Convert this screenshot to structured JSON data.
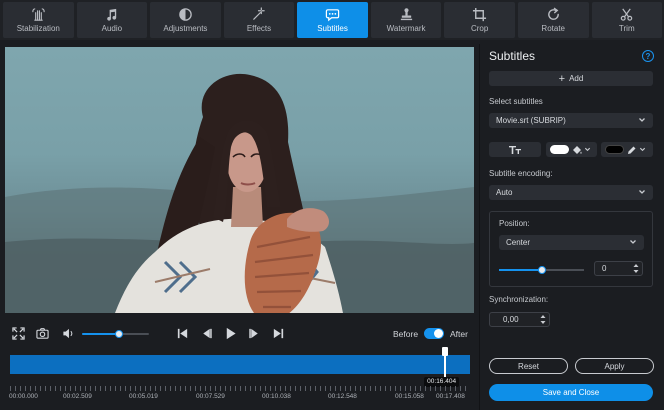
{
  "toolbar": {
    "tabs": [
      {
        "label": "Stabilization",
        "icon": "hand-icon"
      },
      {
        "label": "Audio",
        "icon": "music-note-icon"
      },
      {
        "label": "Adjustments",
        "icon": "contrast-icon"
      },
      {
        "label": "Effects",
        "icon": "magic-wand-icon"
      },
      {
        "label": "Subtitles",
        "icon": "speech-bubble-icon",
        "active": true
      },
      {
        "label": "Watermark",
        "icon": "stamp-icon"
      },
      {
        "label": "Crop",
        "icon": "crop-icon"
      },
      {
        "label": "Rotate",
        "icon": "rotate-icon"
      },
      {
        "label": "Trim",
        "icon": "scissors-icon"
      }
    ]
  },
  "player": {
    "before_label": "Before",
    "after_label": "After",
    "compare_enabled": true,
    "volume": 0.55,
    "current_time": "00:16.404",
    "playhead_fraction": 0.946,
    "ticks": [
      "00:00.000",
      "00:02.509",
      "00:05.019",
      "00:07.529",
      "00:10.038",
      "00:12.548",
      "00:15.058",
      "00:17.408"
    ]
  },
  "subtitles": {
    "title": "Subtitles",
    "add_label": "Add",
    "select_label": "Select subtitles",
    "selected_file": "Movie.srt (SUBRIP)",
    "text_color": "#ffffff",
    "outline_color": "#000000",
    "encoding_label": "Subtitle encoding:",
    "encoding_value": "Auto",
    "position_label": "Position:",
    "position_value": "Center",
    "position_offset": "0",
    "position_slider": 0.5,
    "sync_label": "Synchronization:",
    "sync_value": "0,00",
    "reset_label": "Reset",
    "apply_label": "Apply",
    "save_label": "Save and Close"
  },
  "colors": {
    "accent": "#0e8fe8",
    "panel_bg": "#1b1d21",
    "button_bg": "#2b2e34"
  }
}
